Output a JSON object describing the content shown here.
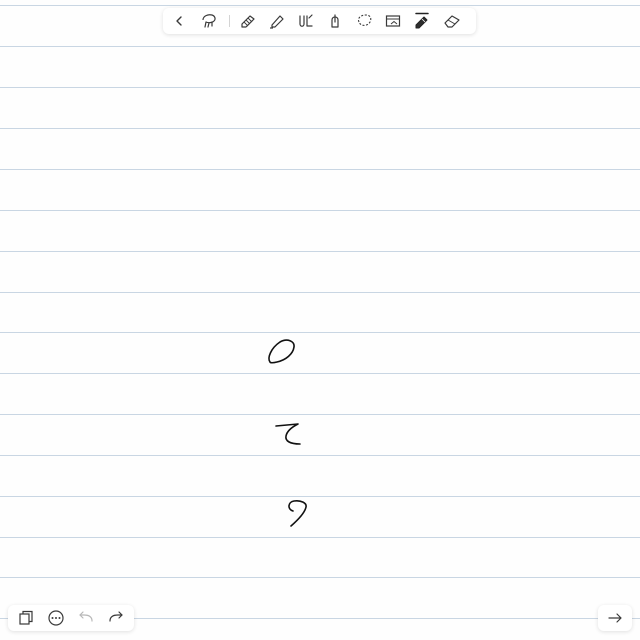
{
  "app": {
    "type": "handwriting-notebook",
    "paper": "ruled"
  },
  "colors": {
    "paper": "#fefefe",
    "rule_line": "#c9d6e3",
    "icon": "#3a3a3a",
    "icon_disabled": "#b8b8b8",
    "ink": "#111111",
    "toolbar_bg": "#ffffff"
  },
  "toolbar": {
    "tools": [
      {
        "name": "back",
        "icon": "chevron-left-icon"
      },
      {
        "name": "lasso",
        "icon": "lasso-icon"
      },
      {
        "name": "pen",
        "icon": "pen-icon"
      },
      {
        "name": "highlighter",
        "icon": "highlighter-icon"
      },
      {
        "name": "text-recognition",
        "icon": "handwriting-icon"
      },
      {
        "name": "shape",
        "icon": "shape-icon"
      },
      {
        "name": "lasso-select",
        "icon": "dashed-lasso-icon"
      },
      {
        "name": "image",
        "icon": "image-icon"
      },
      {
        "name": "pencil",
        "icon": "pencil-icon",
        "active": true
      },
      {
        "name": "eraser",
        "icon": "eraser-icon"
      }
    ]
  },
  "bottom_bar": {
    "left": [
      {
        "name": "pages",
        "icon": "pages-icon"
      },
      {
        "name": "more",
        "icon": "ellipsis-icon"
      },
      {
        "name": "undo",
        "icon": "undo-icon",
        "enabled": false
      },
      {
        "name": "redo",
        "icon": "redo-icon",
        "enabled": true
      }
    ],
    "right": [
      {
        "name": "next-page",
        "icon": "arrow-right-icon"
      }
    ]
  },
  "handwriting": {
    "strokes": 3
  }
}
